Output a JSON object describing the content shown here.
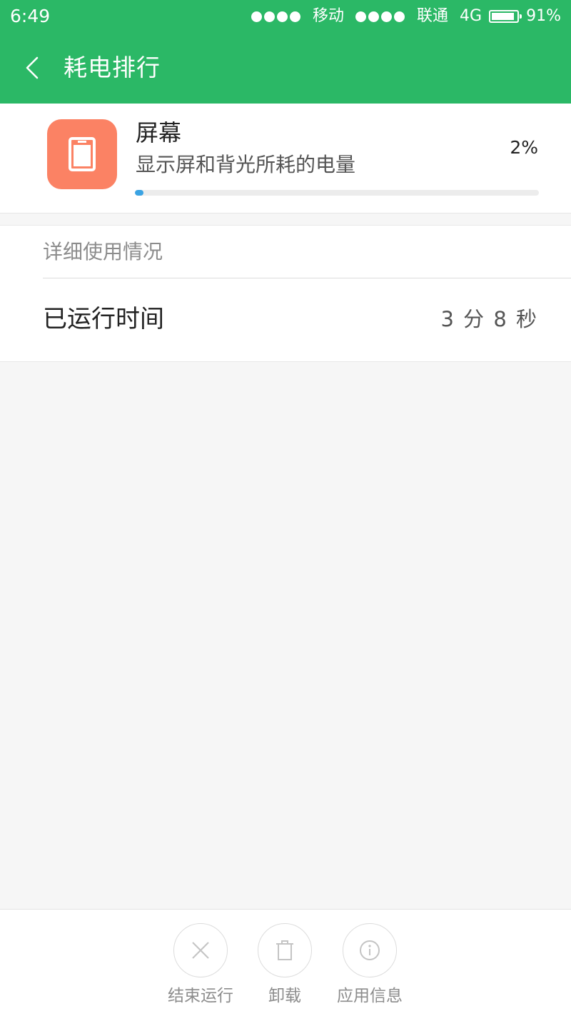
{
  "status_bar": {
    "time": "6:49",
    "carrier_1": "移动",
    "carrier_2": "联通",
    "network": "4G",
    "battery_percent_label": "91%",
    "battery_level": 0.91
  },
  "header": {
    "title": "耗电排行",
    "back_icon": "chevron-left-icon"
  },
  "summary": {
    "icon": "screen-icon",
    "name": "屏幕",
    "description": "显示屏和背光所耗的电量",
    "percent_label": "2%",
    "percent_value": 2
  },
  "details": {
    "section_title": "详细使用情况",
    "rows": [
      {
        "label": "已运行时间",
        "value": "3 分 8 秒"
      }
    ]
  },
  "actions": [
    {
      "label": "结束运行",
      "icon": "close-icon"
    },
    {
      "label": "卸载",
      "icon": "trash-icon"
    },
    {
      "label": "应用信息",
      "icon": "info-icon"
    }
  ],
  "colors": {
    "header_green": "#2bb866",
    "icon_orange": "#fb8264",
    "progress_blue": "#3aa3e3"
  }
}
